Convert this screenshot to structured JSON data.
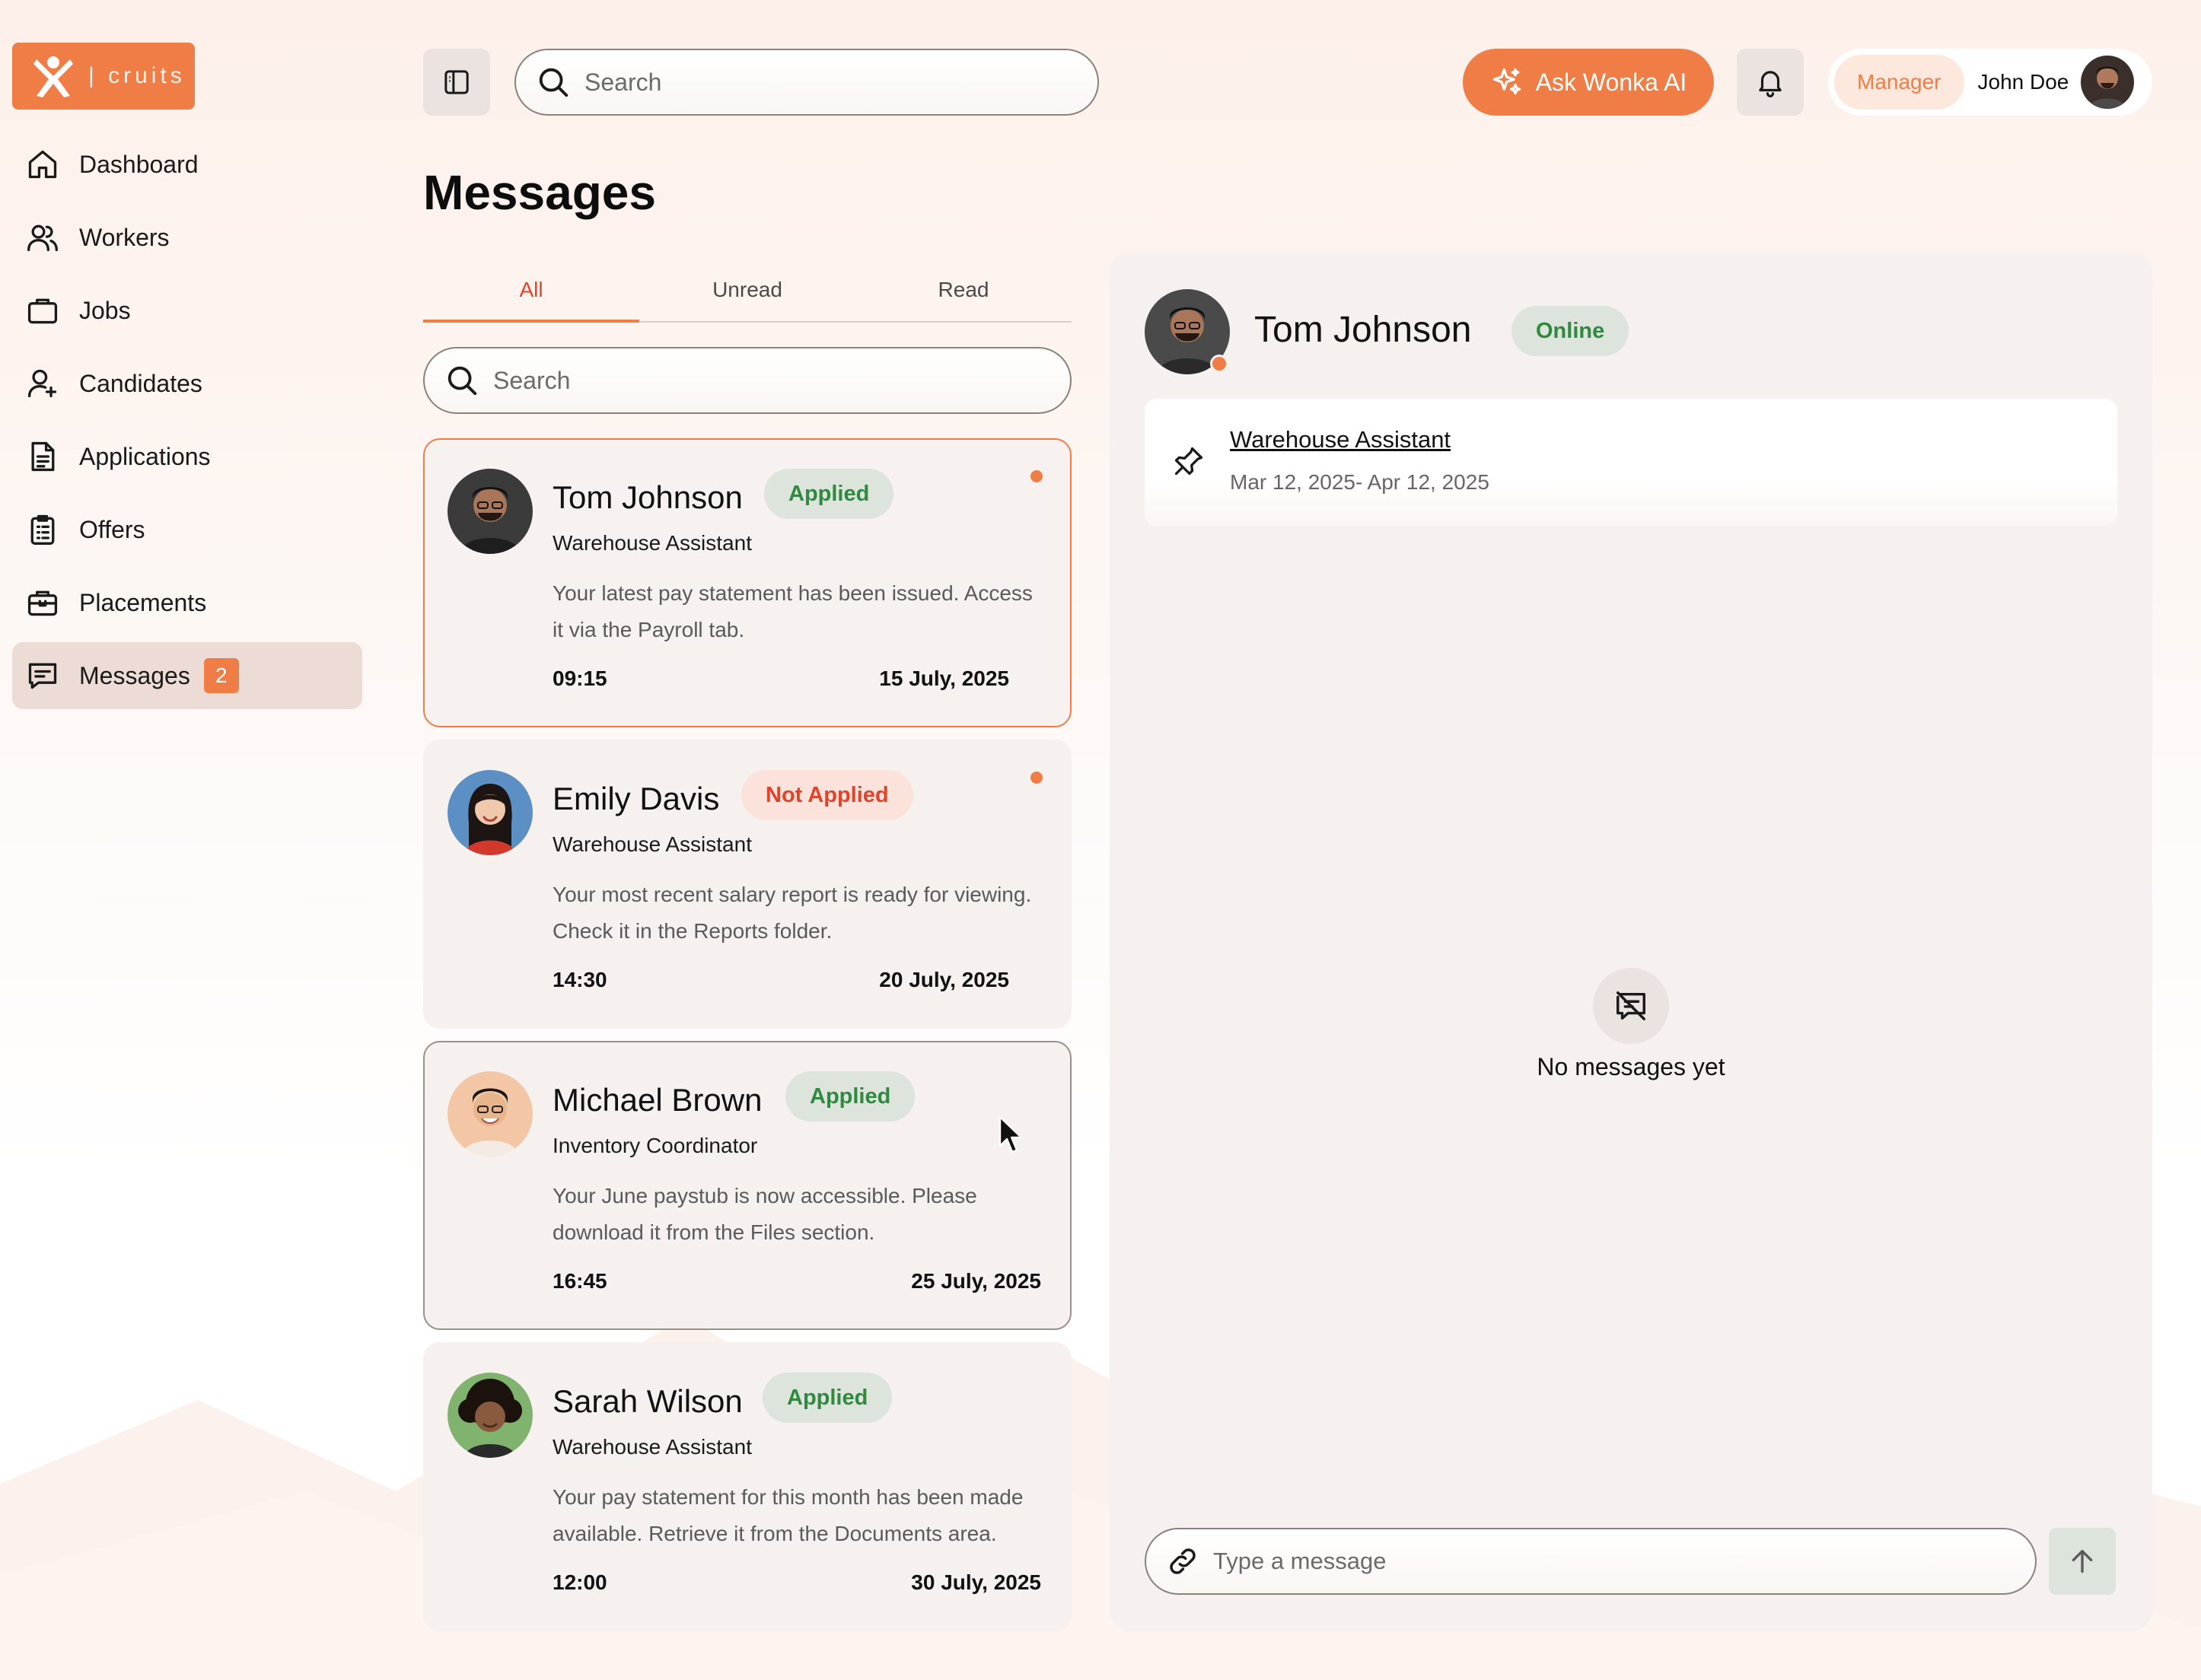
{
  "brand": {
    "logo_text": "| cruits",
    "color": "#ef7d45"
  },
  "sidebar": {
    "items": [
      {
        "label": "Dashboard",
        "icon": "home-icon"
      },
      {
        "label": "Workers",
        "icon": "users-icon"
      },
      {
        "label": "Jobs",
        "icon": "briefcase-icon"
      },
      {
        "label": "Candidates",
        "icon": "user-plus-icon"
      },
      {
        "label": "Applications",
        "icon": "document-icon"
      },
      {
        "label": "Offers",
        "icon": "clipboard-list-icon"
      },
      {
        "label": "Placements",
        "icon": "toolbox-icon"
      },
      {
        "label": "Messages",
        "icon": "message-icon",
        "badge": "2",
        "active": true
      }
    ]
  },
  "topbar": {
    "search_placeholder": "Search",
    "ask_ai_label": "Ask Wonka AI",
    "role": "Manager",
    "user_name": "John Doe"
  },
  "messages": {
    "title": "Messages",
    "tabs": [
      {
        "label": "All",
        "active": true
      },
      {
        "label": "Unread"
      },
      {
        "label": "Read"
      }
    ],
    "search_placeholder": "Search",
    "conversations": [
      {
        "name": "Tom Johnson",
        "status": "Applied",
        "role": "Warehouse Assistant",
        "preview": "Your latest pay statement has been issued. Access it via the Payroll tab.",
        "time": "09:15",
        "date": "15 July, 2025",
        "unread": true,
        "selected": true
      },
      {
        "name": "Emily Davis",
        "status": "Not Applied",
        "role": "Warehouse Assistant",
        "preview": "Your most recent salary report is ready for viewing. Check it in the Reports folder.",
        "time": "14:30",
        "date": "20 July, 2025",
        "unread": true
      },
      {
        "name": "Michael Brown",
        "status": "Applied",
        "role": "Inventory Coordinator",
        "preview": "Your June paystub is now accessible. Please download it from the Files section.",
        "time": "16:45",
        "date": "25 July, 2025",
        "unread": false
      },
      {
        "name": "Sarah Wilson",
        "status": "Applied",
        "role": "Warehouse Assistant",
        "preview": "Your pay statement for this month has been made available. Retrieve it from the Documents area.",
        "time": "12:00",
        "date": "30 July, 2025",
        "unread": false
      }
    ]
  },
  "chat": {
    "name": "Tom Johnson",
    "presence": "Online",
    "pinned_job": "Warehouse Assistant",
    "pinned_dates": "Mar 12, 2025- Apr 12, 2025",
    "empty_text": "No messages yet",
    "compose_placeholder": "Type a message"
  },
  "colors": {
    "accent": "#ef7d45",
    "applied": "#2f8a3f",
    "not_applied": "#e0442b",
    "panel": "#f6f0ee"
  }
}
